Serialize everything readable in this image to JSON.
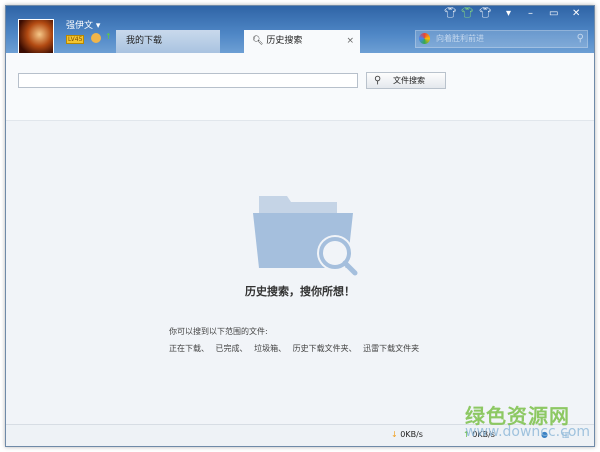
{
  "user": {
    "name": "强伊文",
    "level": "LV45"
  },
  "tabs": [
    {
      "label": "我的下载"
    },
    {
      "label": "历史搜索",
      "close": "×"
    }
  ],
  "top_search": {
    "placeholder": "向着胜利前进"
  },
  "window_controls": [
    "minimize",
    "maximize",
    "close"
  ],
  "search": {
    "value": "",
    "button": "文件搜索"
  },
  "empty": {
    "slogan": "历史搜索，搜你所想！",
    "hint_title": "你可以搜到以下范围的文件:",
    "hint_scope": "正在下载、 已完成、 垃圾箱、 历史下载文件夹、 迅雷下载文件夹"
  },
  "status": {
    "down_speed": "0KB/s",
    "up_speed": "0KB/s"
  },
  "watermark": {
    "text": "绿色资源网",
    "url": "www.downcc.com"
  }
}
